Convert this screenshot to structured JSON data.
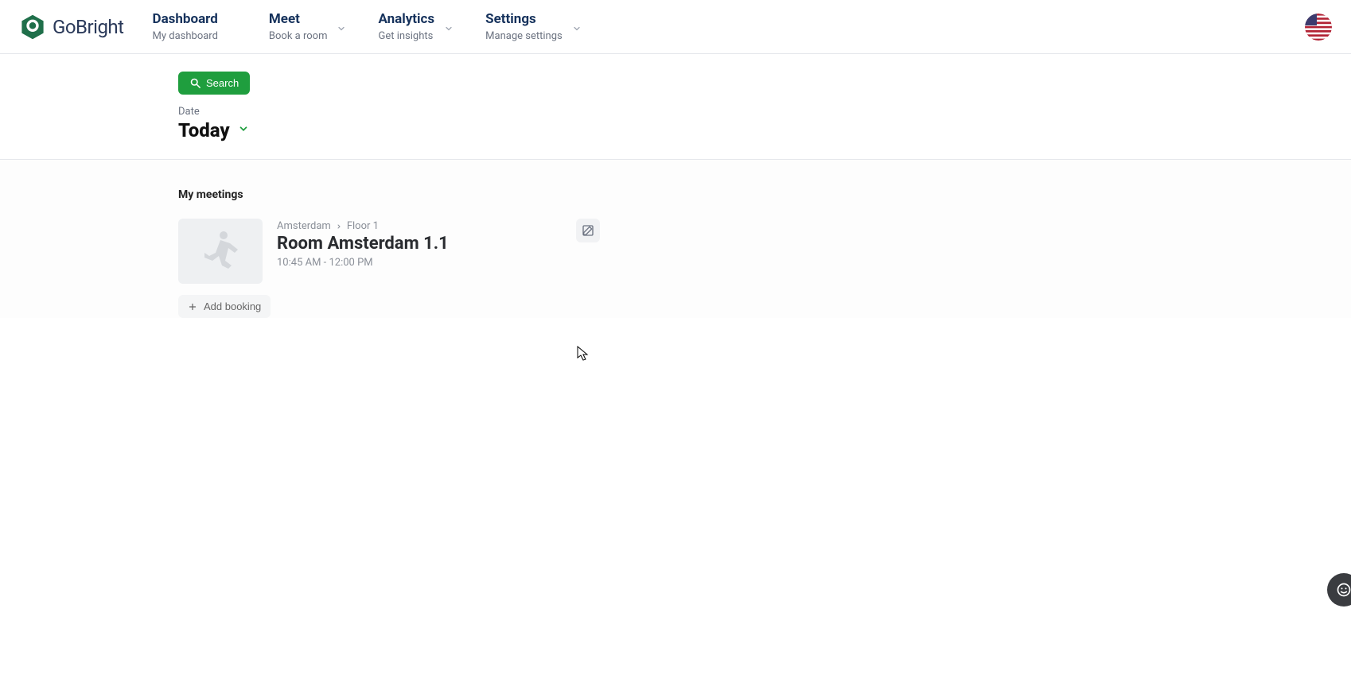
{
  "brand": {
    "name": "GoBright"
  },
  "nav": {
    "items": [
      {
        "title": "Dashboard",
        "sub": "My dashboard",
        "dropdown": false
      },
      {
        "title": "Meet",
        "sub": "Book a room",
        "dropdown": true
      },
      {
        "title": "Analytics",
        "sub": "Get insights",
        "dropdown": true
      },
      {
        "title": "Settings",
        "sub": "Manage settings",
        "dropdown": true
      }
    ]
  },
  "filter": {
    "search_label": "Search",
    "date_label": "Date",
    "date_value": "Today"
  },
  "section": {
    "my_meetings_title": "My meetings",
    "meeting": {
      "breadcrumb_location": "Amsterdam",
      "breadcrumb_floor": "Floor 1",
      "title": "Room Amsterdam 1.1",
      "time": "10:45 AM - 12:00 PM"
    },
    "add_booking_label": "Add booking"
  }
}
